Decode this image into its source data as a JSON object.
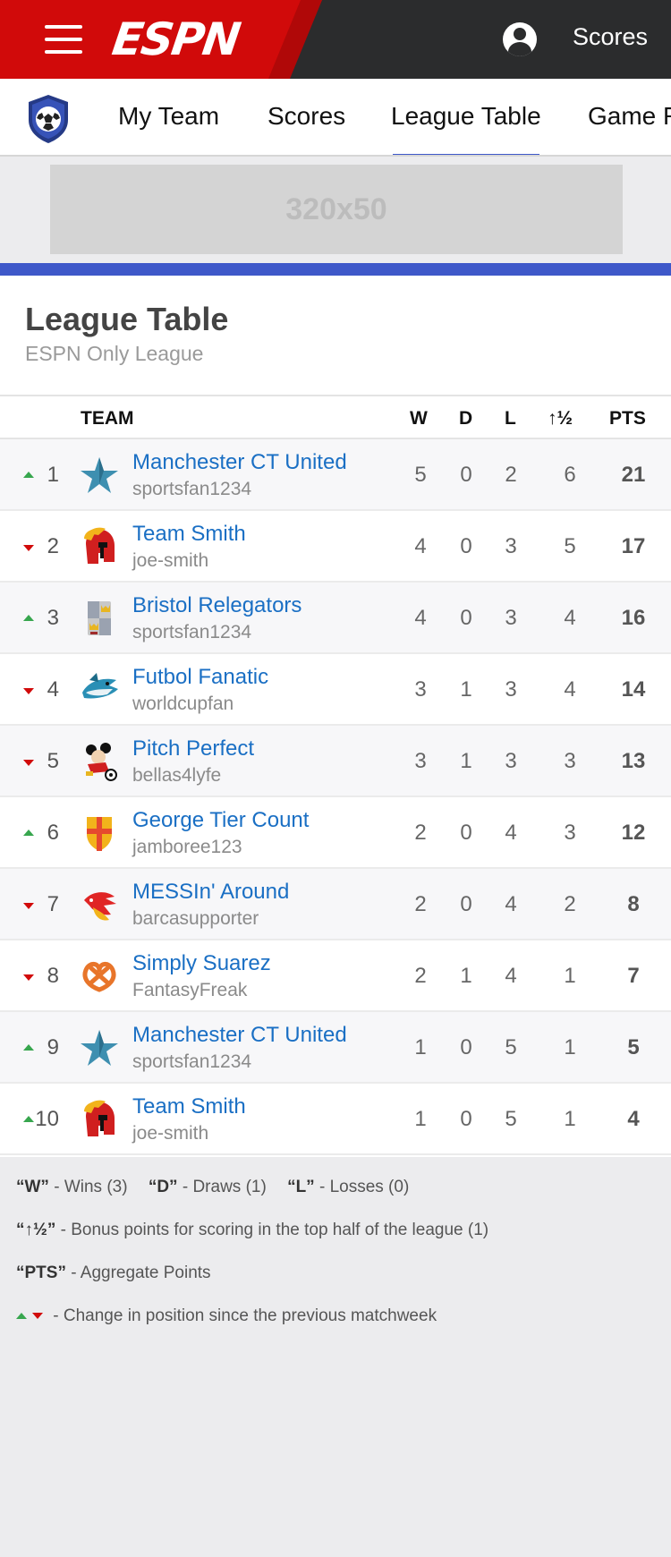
{
  "header": {
    "logo": "ESPN",
    "scores_label": "Scores",
    "colors": {
      "brand_red": "#d10a0a",
      "bar_dark": "#2b2c2d",
      "accent_blue": "#3e58c9",
      "link_blue": "#1a6fc4"
    }
  },
  "nav": {
    "tabs": [
      {
        "label": "My Team"
      },
      {
        "label": "Scores"
      },
      {
        "label": "League Table",
        "active": true
      },
      {
        "label": "Game R"
      }
    ]
  },
  "ad": {
    "label": "320x50"
  },
  "page": {
    "title": "League Table",
    "subtitle": "ESPN Only League"
  },
  "table": {
    "headers": {
      "team": "TEAM",
      "w": "W",
      "d": "D",
      "l": "L",
      "bonus": "↑½",
      "pts": "PTS"
    },
    "rows": [
      {
        "rank": "1",
        "change": "up",
        "logo_icon": "star-icon",
        "team": "Manchester CT United",
        "owner": "sportsfan1234",
        "w": "5",
        "d": "0",
        "l": "2",
        "bonus": "6",
        "pts": "21"
      },
      {
        "rank": "2",
        "change": "down",
        "logo_icon": "spartan-helmet-icon",
        "team": "Team Smith",
        "owner": "joe-smith",
        "w": "4",
        "d": "0",
        "l": "3",
        "bonus": "5",
        "pts": "17"
      },
      {
        "rank": "3",
        "change": "up",
        "logo_icon": "crest-icon",
        "team": "Bristol Relegators",
        "owner": "sportsfan1234",
        "w": "4",
        "d": "0",
        "l": "3",
        "bonus": "4",
        "pts": "16"
      },
      {
        "rank": "4",
        "change": "down",
        "logo_icon": "shark-icon",
        "team": "Futbol Fanatic",
        "owner": "worldcupfan",
        "w": "3",
        "d": "1",
        "l": "3",
        "bonus": "4",
        "pts": "14"
      },
      {
        "rank": "5",
        "change": "down",
        "logo_icon": "mouse-mascot-icon",
        "team": "Pitch Perfect",
        "owner": "bellas4lyfe",
        "w": "3",
        "d": "1",
        "l": "3",
        "bonus": "3",
        "pts": "13"
      },
      {
        "rank": "6",
        "change": "up",
        "logo_icon": "cross-shield-icon",
        "team": "George Tier Count",
        "owner": "jamboree123",
        "w": "2",
        "d": "0",
        "l": "4",
        "bonus": "3",
        "pts": "12"
      },
      {
        "rank": "7",
        "change": "down",
        "logo_icon": "flame-bird-icon",
        "team": "MESSIn' Around",
        "owner": "barcasupporter",
        "w": "2",
        "d": "0",
        "l": "4",
        "bonus": "2",
        "pts": "8"
      },
      {
        "rank": "8",
        "change": "down",
        "logo_icon": "pretzel-icon",
        "team": "Simply Suarez",
        "owner": "FantasyFreak",
        "w": "2",
        "d": "1",
        "l": "4",
        "bonus": "1",
        "pts": "7"
      },
      {
        "rank": "9",
        "change": "up",
        "logo_icon": "star-icon",
        "team": "Manchester CT United",
        "owner": "sportsfan1234",
        "w": "1",
        "d": "0",
        "l": "5",
        "bonus": "1",
        "pts": "5"
      },
      {
        "rank": "10",
        "change": "up",
        "logo_icon": "spartan-helmet-icon",
        "team": "Team Smith",
        "owner": "joe-smith",
        "w": "1",
        "d": "0",
        "l": "5",
        "bonus": "1",
        "pts": "4"
      }
    ]
  },
  "legend": {
    "w_key": "“W”",
    "w_text": "- Wins (3)",
    "d_key": "“D”",
    "d_text": "- Draws (1)",
    "l_key": "“L”",
    "l_text": "- Losses (0)",
    "bonus_key": "“↑½”",
    "bonus_text": "- Bonus points for scoring in the top half of the league (1)",
    "pts_key": "“PTS”",
    "pts_text": "- Aggregate Points",
    "change_text": "- Change in position since the previous matchweek"
  }
}
